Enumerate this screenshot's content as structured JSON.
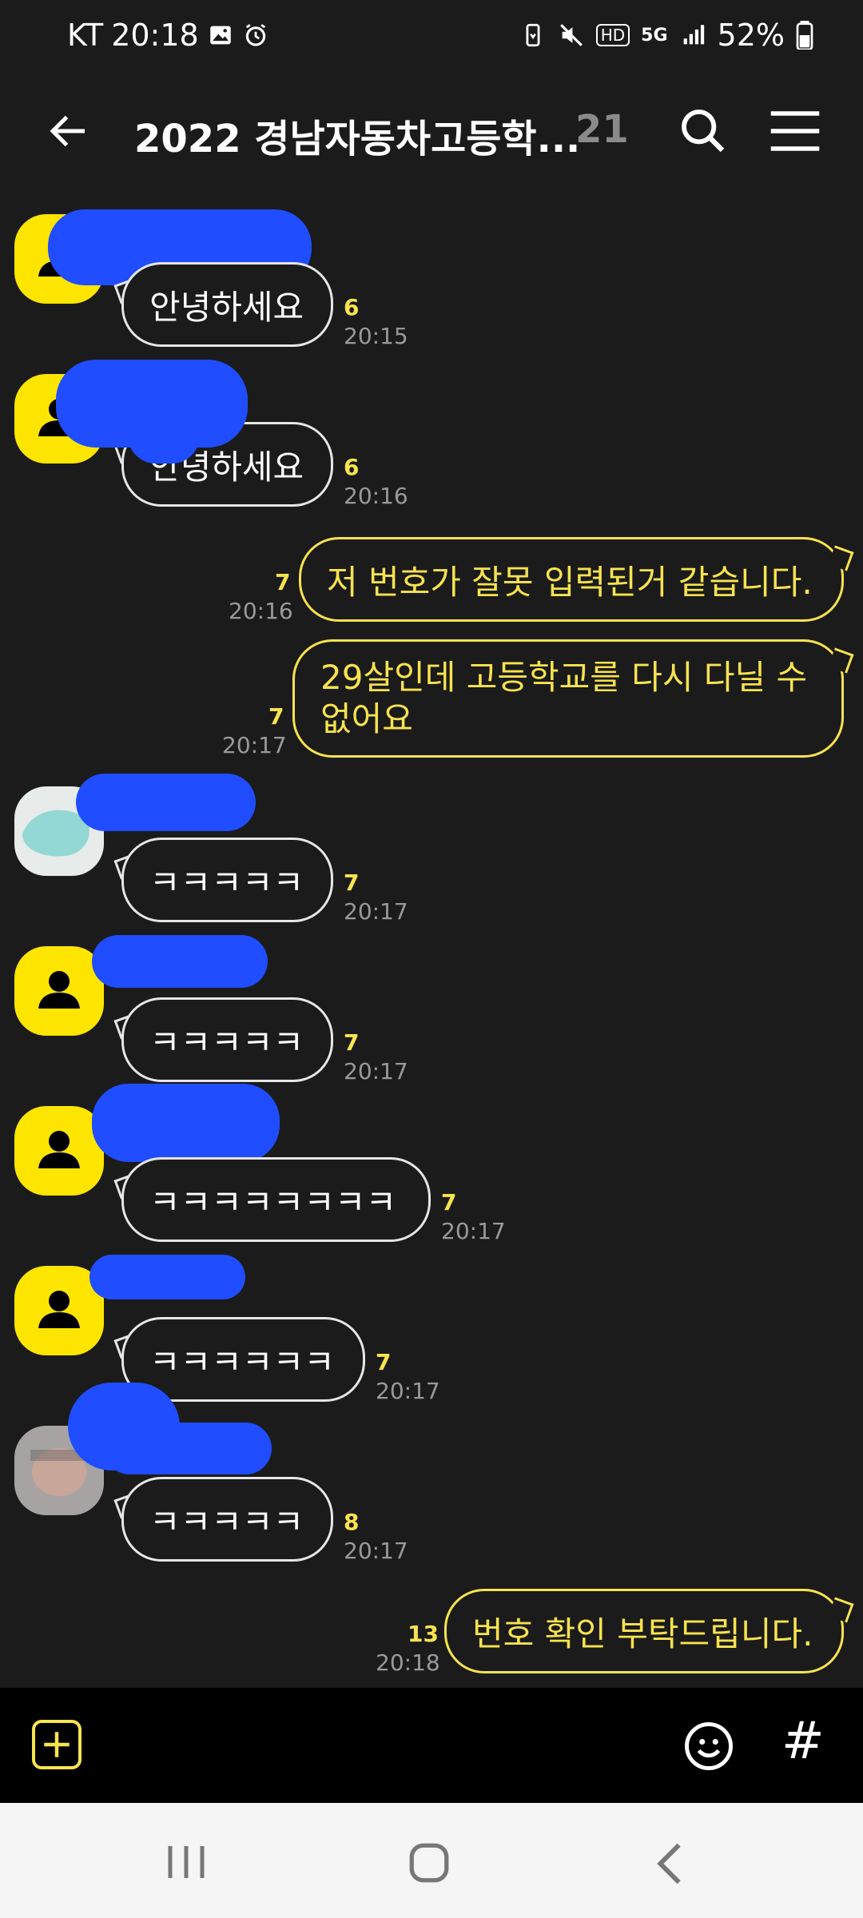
{
  "status": {
    "carrier": "KT",
    "time": "20:18",
    "battery": "52%",
    "network": "5G",
    "hd": "HD"
  },
  "header": {
    "title": "2022 경남자동차고등학...",
    "member_count": "21"
  },
  "messages": [
    {
      "sender": "other",
      "text": "안녕하세요",
      "unread": "6",
      "time": "20:15"
    },
    {
      "sender": "other",
      "text": "안녕하세요",
      "unread": "6",
      "time": "20:16"
    },
    {
      "sender": "me",
      "text": "저 번호가 잘못 입력된거 같습니다.",
      "unread": "7",
      "time": "20:16"
    },
    {
      "sender": "me",
      "text_line1": "29살인데 고등학교를 다시 다닐 수",
      "text_line2": "없어요",
      "unread": "7",
      "time": "20:17"
    },
    {
      "sender": "other",
      "text": "ㅋㅋㅋㅋㅋ",
      "unread": "7",
      "time": "20:17"
    },
    {
      "sender": "other",
      "text": "ㅋㅋㅋㅋㅋ",
      "unread": "7",
      "time": "20:17"
    },
    {
      "sender": "other",
      "text": "ㅋㅋㅋㅋㅋㅋㅋㅋ",
      "unread": "7",
      "time": "20:17"
    },
    {
      "sender": "other",
      "text": "ㅋㅋㅋㅋㅋㅋ",
      "unread": "7",
      "time": "20:17"
    },
    {
      "sender": "other",
      "text": "ㅋㅋㅋㅋㅋ",
      "unread": "8",
      "time": "20:17"
    },
    {
      "sender": "me",
      "text": "번호 확인 부탁드립니다.",
      "unread": "13",
      "time": "20:18"
    }
  ],
  "composer": {
    "hash_label": "#"
  },
  "colors": {
    "accent": "#f7e34f",
    "background": "#1b1b1b",
    "redaction": "#1f4dff",
    "avatar_default": "#fde500"
  },
  "icons": [
    "back-arrow-icon",
    "search-icon",
    "menu-icon",
    "plus-icon",
    "emoji-icon",
    "recents-icon",
    "home-icon",
    "nav-back-icon"
  ]
}
